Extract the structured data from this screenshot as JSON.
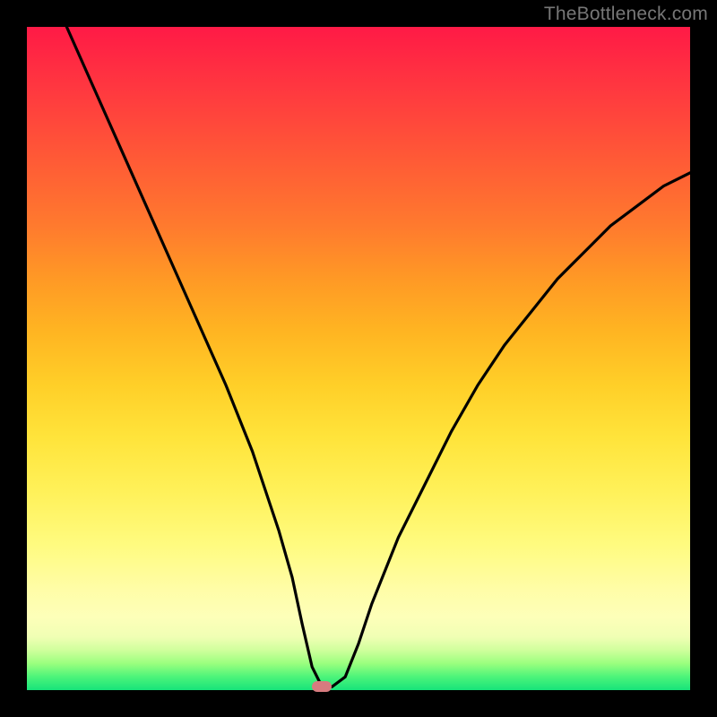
{
  "watermark": "TheBottleneck.com",
  "chart_data": {
    "type": "line",
    "title": "",
    "xlabel": "",
    "ylabel": "",
    "xlim": [
      0,
      100
    ],
    "ylim": [
      0,
      100
    ],
    "series": [
      {
        "name": "curve",
        "x": [
          6,
          10,
          14,
          18,
          22,
          26,
          30,
          34,
          36,
          38,
          40,
          41.5,
          43,
          44.5,
          46,
          48,
          50,
          52,
          56,
          60,
          64,
          68,
          72,
          76,
          80,
          84,
          88,
          92,
          96,
          100
        ],
        "y": [
          100,
          91,
          82,
          73,
          64,
          55,
          46,
          36,
          30,
          24,
          17,
          10,
          3.5,
          0.5,
          0.5,
          2,
          7,
          13,
          23,
          31,
          39,
          46,
          52,
          57,
          62,
          66,
          70,
          73,
          76,
          78
        ]
      }
    ],
    "marker": {
      "x": 44.5,
      "y": 0.5,
      "color": "#d77b7f"
    },
    "gradient_stops": [
      {
        "pct": 0,
        "color": "#ff1a46"
      },
      {
        "pct": 50,
        "color": "#ffd727"
      },
      {
        "pct": 90,
        "color": "#fdffb3"
      },
      {
        "pct": 100,
        "color": "#17e37a"
      }
    ]
  }
}
